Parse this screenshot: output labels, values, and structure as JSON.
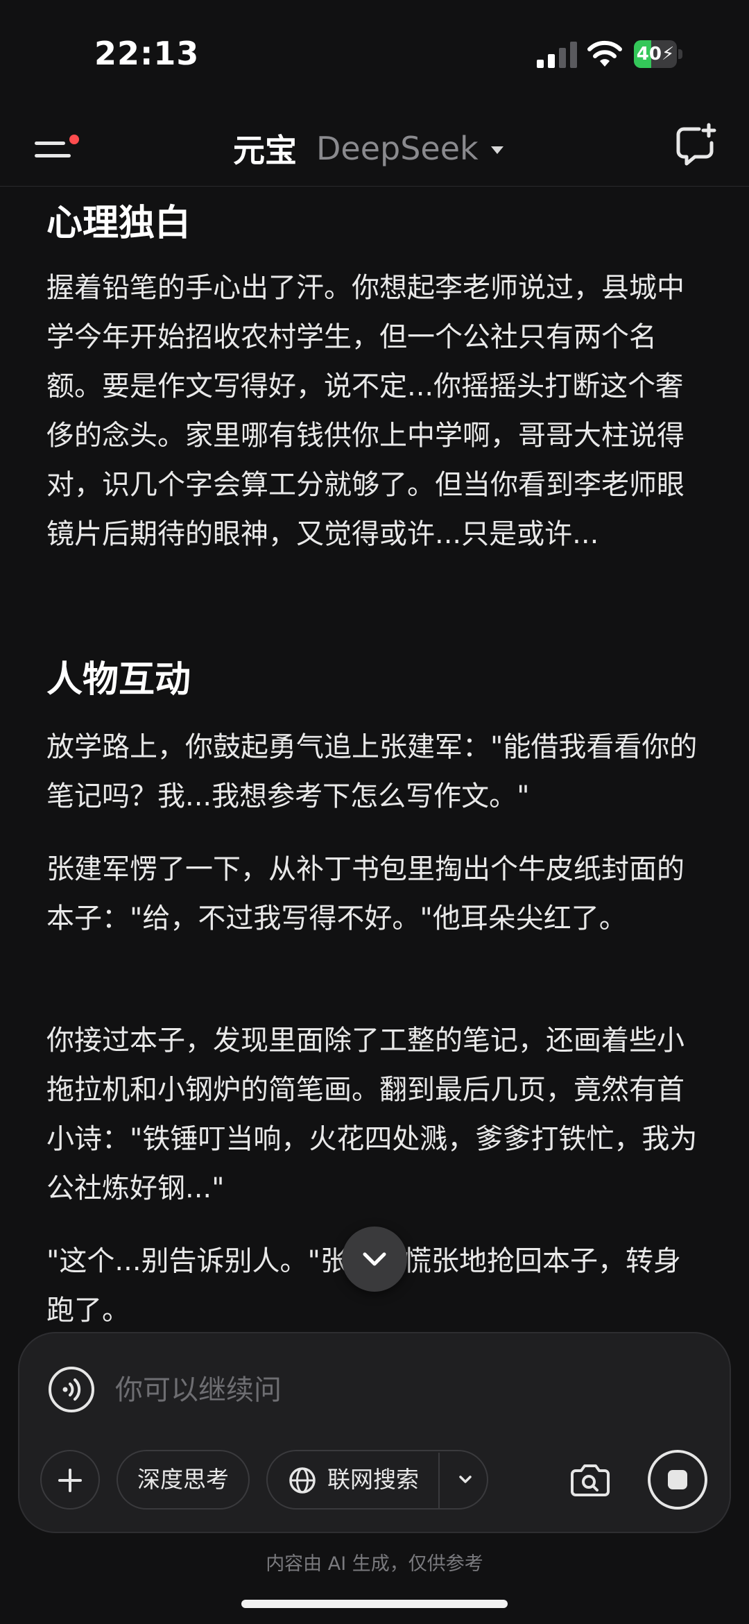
{
  "status_bar": {
    "time": "22:13",
    "battery": {
      "text": "40",
      "level_percent": 40,
      "charging": true,
      "fill_color": "#34c759"
    }
  },
  "header": {
    "menu_icon": "menu-icon",
    "has_notification_dot": true,
    "app_name": "元宝",
    "model_name": "DeepSeek",
    "new_chat_icon": "new-chat-icon"
  },
  "content": {
    "section1": {
      "heading": "心理独白",
      "paragraph": "握着铅笔的手心出了汗。你想起李老师说过，县城中学今年开始招收农村学生，但一个公社只有两个名额。要是作文写得好，说不定...你摇摇头打断这个奢侈的念头。家里哪有钱供你上中学啊，哥哥大柱说得对，识几个字会算工分就够了。但当你看到李老师眼镜片后期待的眼神，又觉得或许...只是或许..."
    },
    "section2": {
      "heading": "人物互动",
      "paragraphs": [
        "放学路上，你鼓起勇气追上张建军：\"能借我看看你的笔记吗？我...我想参考下怎么写作文。\"",
        "张建军愣了一下，从补丁书包里掏出个牛皮纸封面的本子：\"给，不过我写得不好。\"他耳朵尖红了。",
        "你接过本子，发现里面除了工整的笔记，还画着些小拖拉机和小钢炉的简笔画。翻到最后几页，竟然有首小诗：\"铁锤叮当响，火花四处溅，爹爹打铁忙，我为公社炼好钢...\"",
        "\"这个...别告诉别人。\"张建军慌张地抢回本子，转身跑了。"
      ]
    }
  },
  "input_panel": {
    "placeholder": "你可以继续问",
    "deep_think_label": "深度思考",
    "web_search_label": "联网搜索"
  },
  "disclaimer": "内容由 AI 生成，仅供参考"
}
